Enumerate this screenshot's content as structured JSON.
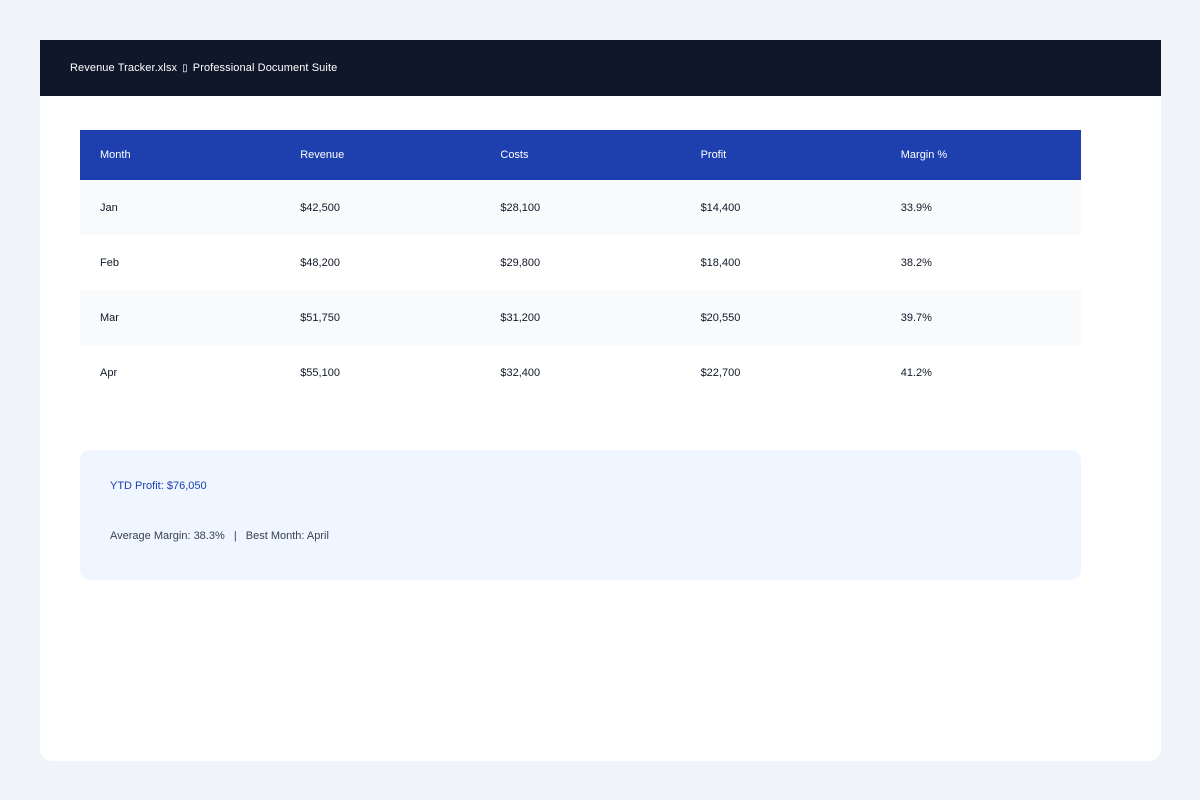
{
  "window": {
    "filename": "Revenue Tracker.xlsx",
    "separator_glyph": "▯",
    "app_name": "Professional Document Suite"
  },
  "table": {
    "headers": [
      "Month",
      "Revenue",
      "Costs",
      "Profit",
      "Margin %"
    ],
    "rows": [
      [
        "Jan",
        "$42,500",
        "$28,100",
        "$14,400",
        "33.9%"
      ],
      [
        "Feb",
        "$48,200",
        "$29,800",
        "$18,400",
        "38.2%"
      ],
      [
        "Mar",
        "$51,750",
        "$31,200",
        "$20,550",
        "39.7%"
      ],
      [
        "Apr",
        "$55,100",
        "$32,400",
        "$22,700",
        "41.2%"
      ]
    ]
  },
  "summary": {
    "ytd_profit": "YTD Profit: $76,050",
    "average_margin": "Average Margin: 38.3%",
    "divider": "|",
    "best_month": "Best Month: April"
  },
  "colors": {
    "titlebar": "#0f172a",
    "header": "#1e40af",
    "summary_bg": "#eff6ff",
    "accent_text": "#1e40af"
  }
}
